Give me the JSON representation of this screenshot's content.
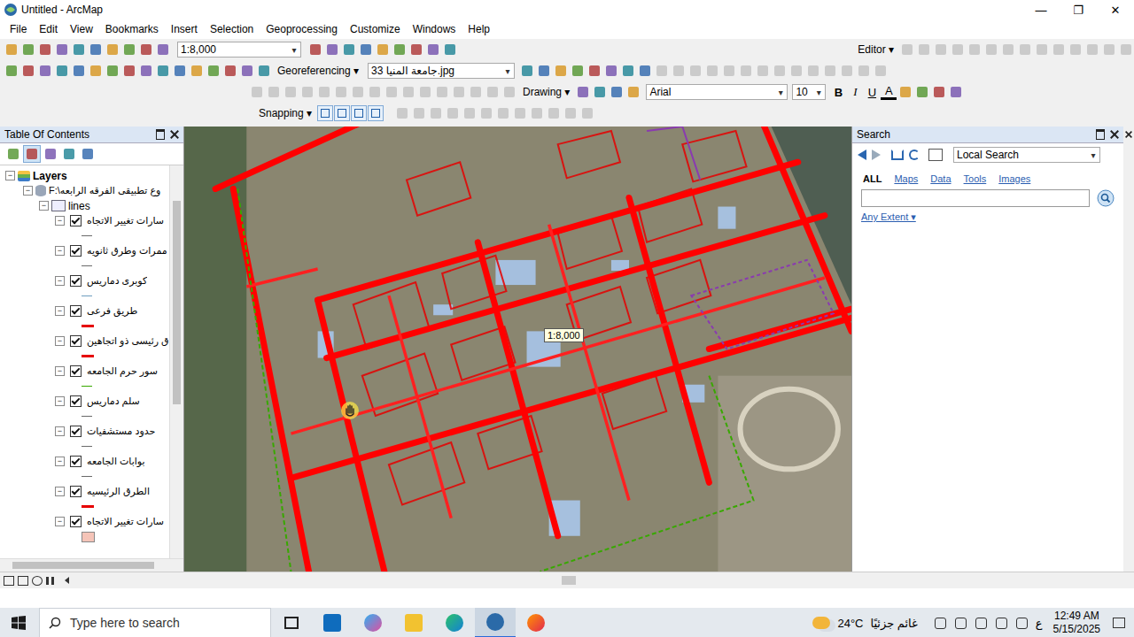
{
  "window": {
    "title": "Untitled - ArcMap",
    "controls": [
      "—",
      "❐",
      "✕"
    ]
  },
  "menu": [
    "File",
    "Edit",
    "View",
    "Bookmarks",
    "Insert",
    "Selection",
    "Geoprocessing",
    "Customize",
    "Windows",
    "Help"
  ],
  "toolbar": {
    "scale": "1:8,000",
    "editor": "Editor",
    "georeferencing": "Georeferencing",
    "georef_layer": "جامعة المنيا 33.jpg",
    "drawing": "Drawing",
    "font": "Arial",
    "font_size": "10",
    "format_buttons": [
      "B",
      "I",
      "U"
    ],
    "font_color": "A",
    "snapping": "Snapping",
    "dropdown_arrow": "▾"
  },
  "toc": {
    "title": "Table Of Contents",
    "root": "Layers",
    "dataframe": "F:\\وع تطبيقى الفرقه الرابعه",
    "group": "lines",
    "layers": [
      {
        "name": "سارات تغيير الاتجاه",
        "checked": true,
        "kind": "line",
        "color": "#6a6a6a"
      },
      {
        "name": "ممرات وطرق ثانويه",
        "checked": true,
        "kind": "line",
        "color": "#6a6a6a"
      },
      {
        "name": "كوبرى دماريس",
        "checked": true,
        "kind": "line",
        "color": "#6f9fbf"
      },
      {
        "name": "طريق فرعى",
        "checked": true,
        "kind": "thick",
        "color": "#e60000"
      },
      {
        "name": "ق رئيسى ذو اتجاهين",
        "checked": true,
        "kind": "thick",
        "color": "#e60000"
      },
      {
        "name": "سور حرم الجامعه",
        "checked": true,
        "kind": "line",
        "color": "#38a800"
      },
      {
        "name": "سلم دماريس",
        "checked": true,
        "kind": "line",
        "color": "#6a6a6a"
      },
      {
        "name": "حدود مستشفيات",
        "checked": true,
        "kind": "line",
        "color": "#6a6a6a"
      },
      {
        "name": "بوابات الجامعه",
        "checked": true,
        "kind": "line",
        "color": "#6a6a6a"
      },
      {
        "name": "الطرق الرئيسيه",
        "checked": true,
        "kind": "thick",
        "color": "#e60000"
      },
      {
        "name": "سارات تغيير الاتجاه",
        "checked": true,
        "kind": "fill",
        "color": "#f5c4b8"
      }
    ]
  },
  "map": {
    "scale_tip": "1:8,000"
  },
  "search": {
    "title": "Search",
    "scope": "Local Search",
    "input": "",
    "filters": [
      {
        "label": "ALL",
        "selected": true
      },
      {
        "label": "Maps",
        "selected": false
      },
      {
        "label": "Data",
        "selected": false
      },
      {
        "label": "Tools",
        "selected": false
      },
      {
        "label": "Images",
        "selected": false
      }
    ],
    "extent": "Any Extent"
  },
  "taskbar": {
    "search_placeholder": "Type here to search",
    "temperature": "24°C",
    "weather": "غائم جزئيًا",
    "language": "ع",
    "time": "12:49 AM",
    "date": "5/15/2025"
  }
}
